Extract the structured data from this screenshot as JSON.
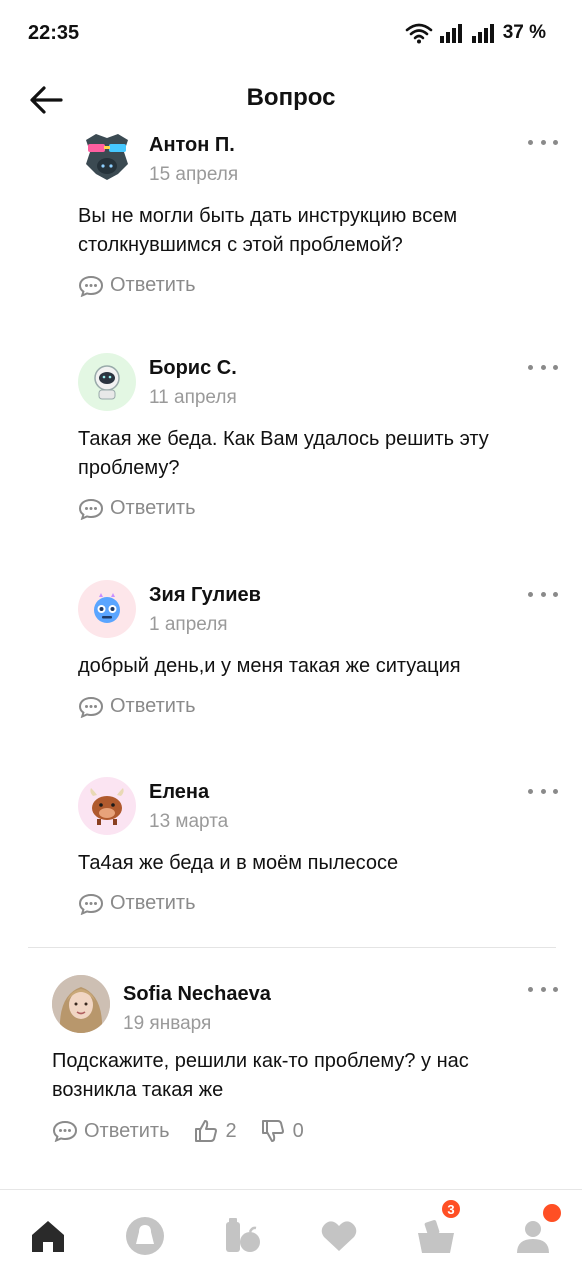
{
  "status_bar": {
    "time": "22:35",
    "battery": "37 %"
  },
  "header": {
    "title": "Вопрос"
  },
  "comments": [
    {
      "author": "Антон П.",
      "date": "15 апреля",
      "text": "Вы не могли быть дать инструкцию всем столкнувшимся с этой проблемой?",
      "reply_label": "Ответить"
    },
    {
      "author": "Борис С.",
      "date": "11 апреля",
      "text": "Такая же беда. Как Вам удалось решить эту проблему?",
      "reply_label": "Ответить"
    },
    {
      "author": "Зия Гулиев",
      "date": "1 апреля",
      "text": "добрый день,и у меня такая же ситуация",
      "reply_label": "Ответить"
    },
    {
      "author": "Елена",
      "date": "13 марта",
      "text": "Та4ая же беда и в моём пылесосе",
      "reply_label": "Ответить"
    }
  ],
  "top_comment": {
    "author": "Sofia Nechaeva",
    "date": "19 января",
    "text": "Подскажите, решили как-то проблему? у нас возникла такая же",
    "reply_label": "Ответить",
    "likes": "2",
    "dislikes": "0"
  },
  "bottom_nav": {
    "cart_badge": "3"
  },
  "colors": {
    "accent": "#ff4f24",
    "muted": "#8a8a8a",
    "icon_gray": "#c4c4c4",
    "home_active": "#2a2a2a"
  }
}
